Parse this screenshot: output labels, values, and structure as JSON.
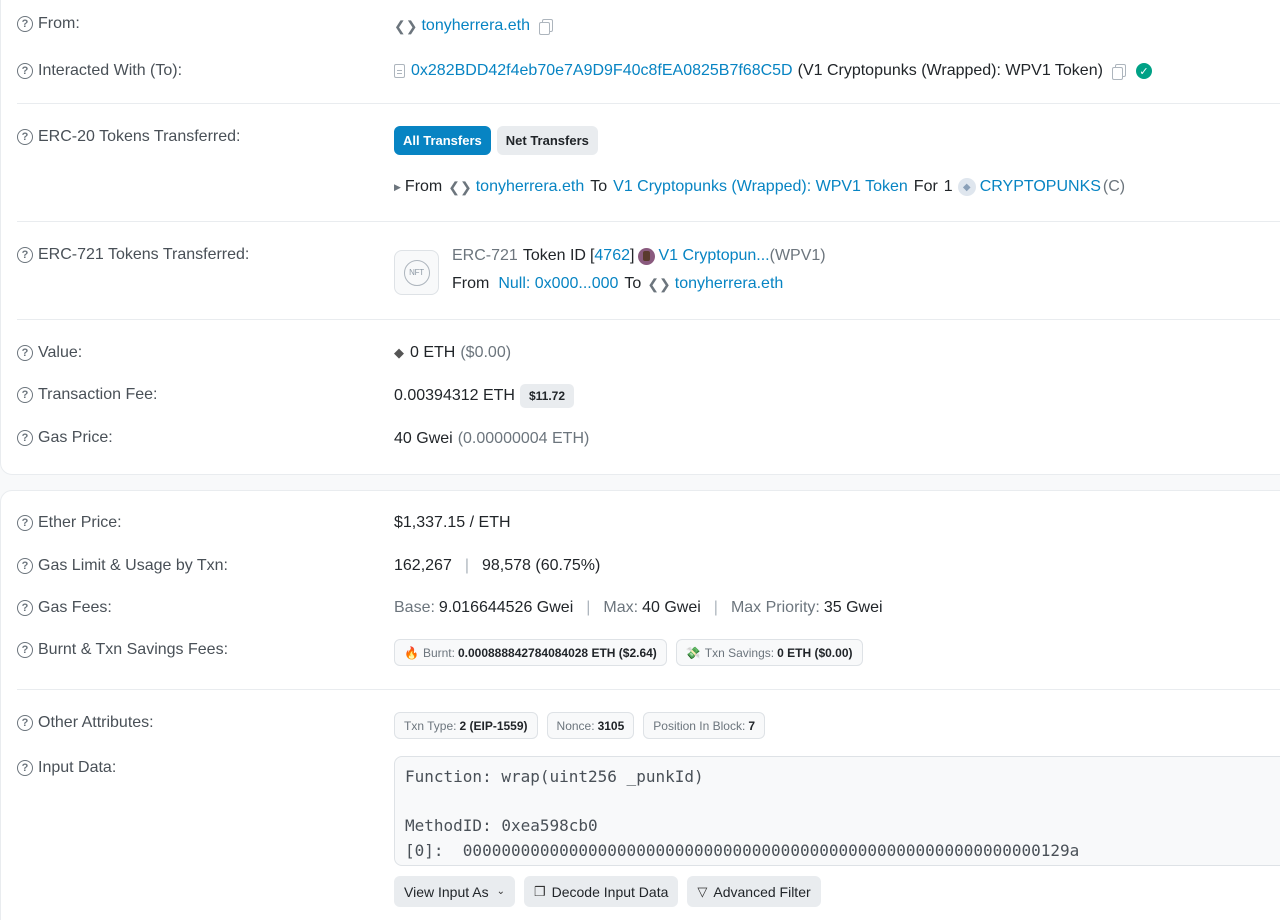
{
  "from": {
    "label": "From:",
    "address": "tonyherrera.eth"
  },
  "interacted_with": {
    "label": "Interacted With (To):",
    "address": "0x282BDD42f4eb70e7A9D9F40c8fEA0825B7f68C5D",
    "name": "(V1 Cryptopunks (Wrapped): WPV1 Token)"
  },
  "erc20": {
    "label": "ERC-20 Tokens Transferred:",
    "tab_all": "All Transfers",
    "tab_net": "Net Transfers",
    "from_word": "From",
    "from_addr": "tonyherrera.eth",
    "to_word": "To",
    "to_addr": "V1 Cryptopunks (Wrapped): WPV1 Token",
    "for_word": "For",
    "amount": "1",
    "token": "CRYPTOPUNKS",
    "token_suffix": "(C)"
  },
  "erc721": {
    "label": "ERC-721 Tokens Transferred:",
    "nft_icon_text": "NFT",
    "standard": "ERC-721",
    "token_id_label": "Token ID",
    "open_bracket": "[",
    "token_id": "4762",
    "close_bracket": "]",
    "token_name": "V1 Cryptopun...",
    "token_symbol": "(WPV1)",
    "from_word": "From",
    "from_addr": "Null: 0x000...000",
    "to_word": "To",
    "to_addr": "tonyherrera.eth"
  },
  "value": {
    "label": "Value:",
    "amount": "0 ETH",
    "usd": "($0.00)"
  },
  "fee": {
    "label": "Transaction Fee:",
    "amount": "0.00394312 ETH",
    "usd": "$11.72"
  },
  "gas_price": {
    "label": "Gas Price:",
    "amount": "40 Gwei",
    "eth": "(0.00000004 ETH)"
  },
  "ether_price": {
    "label": "Ether Price:",
    "value": "$1,337.15 / ETH"
  },
  "gas_limit": {
    "label": "Gas Limit & Usage by Txn:",
    "limit": "162,267",
    "separator": "|",
    "usage": "98,578 (60.75%)"
  },
  "gas_fees": {
    "label": "Gas Fees:",
    "base_label": "Base:",
    "base": "9.016644526 Gwei",
    "separator": "|",
    "max_label": "Max:",
    "max": "40 Gwei",
    "priority_label": "Max Priority:",
    "priority": "35 Gwei"
  },
  "burnt": {
    "label": "Burnt & Txn Savings Fees:",
    "burnt_emoji": "🔥",
    "burnt_label": "Burnt:",
    "burnt_value": "0.000888842784084028 ETH ($2.64)",
    "savings_emoji": "💸",
    "savings_label": "Txn Savings:",
    "savings_value": "0 ETH ($0.00)"
  },
  "other": {
    "label": "Other Attributes:",
    "txn_type_label": "Txn Type:",
    "txn_type": "2 (EIP-1559)",
    "nonce_label": "Nonce:",
    "nonce": "3105",
    "position_label": "Position In Block:",
    "position": "7"
  },
  "input": {
    "label": "Input Data:",
    "lines": [
      "Function: wrap(uint256 _punkId)",
      "",
      "MethodID: 0xea598cb0",
      "[0]:  000000000000000000000000000000000000000000000000000000000000129a"
    ],
    "view_as": "View Input As",
    "decode": "Decode Input Data",
    "filter": "Advanced Filter"
  }
}
